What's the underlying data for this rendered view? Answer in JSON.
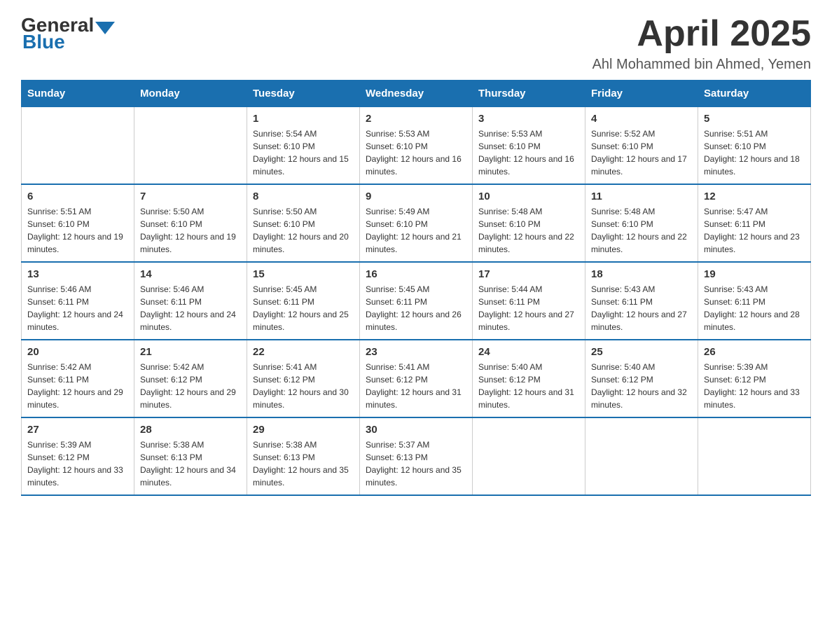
{
  "header": {
    "logo": {
      "general": "General",
      "blue": "Blue"
    },
    "title": "April 2025",
    "location": "Ahl Mohammed bin Ahmed, Yemen"
  },
  "calendar": {
    "days_of_week": [
      "Sunday",
      "Monday",
      "Tuesday",
      "Wednesday",
      "Thursday",
      "Friday",
      "Saturday"
    ],
    "weeks": [
      [
        {
          "day": "",
          "sunrise": "",
          "sunset": "",
          "daylight": ""
        },
        {
          "day": "",
          "sunrise": "",
          "sunset": "",
          "daylight": ""
        },
        {
          "day": "1",
          "sunrise": "Sunrise: 5:54 AM",
          "sunset": "Sunset: 6:10 PM",
          "daylight": "Daylight: 12 hours and 15 minutes."
        },
        {
          "day": "2",
          "sunrise": "Sunrise: 5:53 AM",
          "sunset": "Sunset: 6:10 PM",
          "daylight": "Daylight: 12 hours and 16 minutes."
        },
        {
          "day": "3",
          "sunrise": "Sunrise: 5:53 AM",
          "sunset": "Sunset: 6:10 PM",
          "daylight": "Daylight: 12 hours and 16 minutes."
        },
        {
          "day": "4",
          "sunrise": "Sunrise: 5:52 AM",
          "sunset": "Sunset: 6:10 PM",
          "daylight": "Daylight: 12 hours and 17 minutes."
        },
        {
          "day": "5",
          "sunrise": "Sunrise: 5:51 AM",
          "sunset": "Sunset: 6:10 PM",
          "daylight": "Daylight: 12 hours and 18 minutes."
        }
      ],
      [
        {
          "day": "6",
          "sunrise": "Sunrise: 5:51 AM",
          "sunset": "Sunset: 6:10 PM",
          "daylight": "Daylight: 12 hours and 19 minutes."
        },
        {
          "day": "7",
          "sunrise": "Sunrise: 5:50 AM",
          "sunset": "Sunset: 6:10 PM",
          "daylight": "Daylight: 12 hours and 19 minutes."
        },
        {
          "day": "8",
          "sunrise": "Sunrise: 5:50 AM",
          "sunset": "Sunset: 6:10 PM",
          "daylight": "Daylight: 12 hours and 20 minutes."
        },
        {
          "day": "9",
          "sunrise": "Sunrise: 5:49 AM",
          "sunset": "Sunset: 6:10 PM",
          "daylight": "Daylight: 12 hours and 21 minutes."
        },
        {
          "day": "10",
          "sunrise": "Sunrise: 5:48 AM",
          "sunset": "Sunset: 6:10 PM",
          "daylight": "Daylight: 12 hours and 22 minutes."
        },
        {
          "day": "11",
          "sunrise": "Sunrise: 5:48 AM",
          "sunset": "Sunset: 6:10 PM",
          "daylight": "Daylight: 12 hours and 22 minutes."
        },
        {
          "day": "12",
          "sunrise": "Sunrise: 5:47 AM",
          "sunset": "Sunset: 6:11 PM",
          "daylight": "Daylight: 12 hours and 23 minutes."
        }
      ],
      [
        {
          "day": "13",
          "sunrise": "Sunrise: 5:46 AM",
          "sunset": "Sunset: 6:11 PM",
          "daylight": "Daylight: 12 hours and 24 minutes."
        },
        {
          "day": "14",
          "sunrise": "Sunrise: 5:46 AM",
          "sunset": "Sunset: 6:11 PM",
          "daylight": "Daylight: 12 hours and 24 minutes."
        },
        {
          "day": "15",
          "sunrise": "Sunrise: 5:45 AM",
          "sunset": "Sunset: 6:11 PM",
          "daylight": "Daylight: 12 hours and 25 minutes."
        },
        {
          "day": "16",
          "sunrise": "Sunrise: 5:45 AM",
          "sunset": "Sunset: 6:11 PM",
          "daylight": "Daylight: 12 hours and 26 minutes."
        },
        {
          "day": "17",
          "sunrise": "Sunrise: 5:44 AM",
          "sunset": "Sunset: 6:11 PM",
          "daylight": "Daylight: 12 hours and 27 minutes."
        },
        {
          "day": "18",
          "sunrise": "Sunrise: 5:43 AM",
          "sunset": "Sunset: 6:11 PM",
          "daylight": "Daylight: 12 hours and 27 minutes."
        },
        {
          "day": "19",
          "sunrise": "Sunrise: 5:43 AM",
          "sunset": "Sunset: 6:11 PM",
          "daylight": "Daylight: 12 hours and 28 minutes."
        }
      ],
      [
        {
          "day": "20",
          "sunrise": "Sunrise: 5:42 AM",
          "sunset": "Sunset: 6:11 PM",
          "daylight": "Daylight: 12 hours and 29 minutes."
        },
        {
          "day": "21",
          "sunrise": "Sunrise: 5:42 AM",
          "sunset": "Sunset: 6:12 PM",
          "daylight": "Daylight: 12 hours and 29 minutes."
        },
        {
          "day": "22",
          "sunrise": "Sunrise: 5:41 AM",
          "sunset": "Sunset: 6:12 PM",
          "daylight": "Daylight: 12 hours and 30 minutes."
        },
        {
          "day": "23",
          "sunrise": "Sunrise: 5:41 AM",
          "sunset": "Sunset: 6:12 PM",
          "daylight": "Daylight: 12 hours and 31 minutes."
        },
        {
          "day": "24",
          "sunrise": "Sunrise: 5:40 AM",
          "sunset": "Sunset: 6:12 PM",
          "daylight": "Daylight: 12 hours and 31 minutes."
        },
        {
          "day": "25",
          "sunrise": "Sunrise: 5:40 AM",
          "sunset": "Sunset: 6:12 PM",
          "daylight": "Daylight: 12 hours and 32 minutes."
        },
        {
          "day": "26",
          "sunrise": "Sunrise: 5:39 AM",
          "sunset": "Sunset: 6:12 PM",
          "daylight": "Daylight: 12 hours and 33 minutes."
        }
      ],
      [
        {
          "day": "27",
          "sunrise": "Sunrise: 5:39 AM",
          "sunset": "Sunset: 6:12 PM",
          "daylight": "Daylight: 12 hours and 33 minutes."
        },
        {
          "day": "28",
          "sunrise": "Sunrise: 5:38 AM",
          "sunset": "Sunset: 6:13 PM",
          "daylight": "Daylight: 12 hours and 34 minutes."
        },
        {
          "day": "29",
          "sunrise": "Sunrise: 5:38 AM",
          "sunset": "Sunset: 6:13 PM",
          "daylight": "Daylight: 12 hours and 35 minutes."
        },
        {
          "day": "30",
          "sunrise": "Sunrise: 5:37 AM",
          "sunset": "Sunset: 6:13 PM",
          "daylight": "Daylight: 12 hours and 35 minutes."
        },
        {
          "day": "",
          "sunrise": "",
          "sunset": "",
          "daylight": ""
        },
        {
          "day": "",
          "sunrise": "",
          "sunset": "",
          "daylight": ""
        },
        {
          "day": "",
          "sunrise": "",
          "sunset": "",
          "daylight": ""
        }
      ]
    ]
  }
}
